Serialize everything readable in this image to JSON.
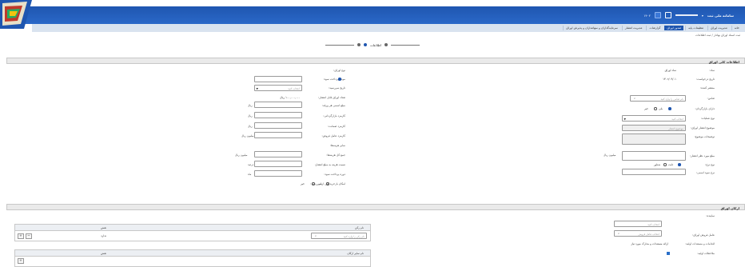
{
  "header": {
    "user": "سامانه ملی ثبت",
    "date": "۱۴۰۲"
  },
  "menu": {
    "items": [
      "خانه",
      "مدیریت اوراق",
      "تنظیمات پایه",
      "صدور اوراق",
      "گزارشات",
      "مدیریت انتشار",
      "سرمایه‌گذاران و سهامداران و پذیرش اوراق"
    ],
    "active_index": 3
  },
  "breadcrumb": "ثبت اسناد اوراق بهادار / ثبت اطلاعات",
  "wizard": {
    "step_label": "اطلاعات"
  },
  "general": {
    "title": "اطلاعات کلی اوراق",
    "right": [
      {
        "label": "نماد:",
        "value": "نماد اوراق"
      },
      {
        "label": "تاریخ درخواست:",
        "value": "۱۴۰۲/۰۹/۰۱"
      },
      {
        "label": "منتشر کننده:",
        "value": ""
      },
      {
        "label": "ضامن:",
        "placeholder": "نام ضامن را وارد کنید"
      },
      {
        "label": "دارای بازارگردان:",
        "radio_yes": "بلی",
        "radio_no": "خیر"
      },
      {
        "label": "نوع عملیات:",
        "option": "انتخاب کنید"
      },
      {
        "label": "موضوع انتشار اوراق:",
        "placeholder": "موضوع انتشار"
      },
      {
        "label": "توضیحات موضوع:",
        "value": ""
      },
      {
        "label": "مبلغ مورد نظر انتشار:",
        "unit": "میلیون ریال"
      },
      {
        "label": "نوع نرخ:",
        "radio_a": "ثابت",
        "radio_b": "شناور"
      },
      {
        "label": "نرخ سود اسمی:",
        "value": ""
      }
    ],
    "left": [
      {
        "label": "نوع اوراق:",
        "value": ""
      },
      {
        "label": "موعد پرداخت سود:",
        "value": ""
      },
      {
        "label": "تاریخ سررسید:",
        "option": "انتخاب کنید"
      },
      {
        "label": "تعداد اوراق قابل انتشار:",
        "value": "۱۰۰,۰۰۰,۰۰۰ ریال"
      },
      {
        "label": "مبلغ اسمی هر ورقه:",
        "unit": "ریال"
      },
      {
        "label": "کارمزد بازارگردانی:",
        "unit": "ریال"
      },
      {
        "label": "کارمزد ضمانت:",
        "unit": "ریال"
      },
      {
        "label": "کارمزد عامل فروش:",
        "unit": "میلیون ریال"
      },
      {
        "label": "سایر هزینه‌ها:",
        "value": ""
      },
      {
        "label": "جمع کل هزینه‌ها:",
        "unit": "میلیون ریال"
      },
      {
        "label": "نسبت هزینه به مبلغ انتشار:",
        "unit": "درصد"
      },
      {
        "label": "دوره پرداخت سود:",
        "unit": "ماه"
      },
      {
        "label": "امکان بازخرید قبل از سررسید:",
        "radio_a": "بلی",
        "radio_b": "خیر"
      }
    ]
  },
  "pillars": {
    "title": "ارکان اوراق",
    "right": [
      {
        "label": "نماینده:",
        "placeholder": "انتخاب کنید"
      },
      {
        "label": "عامل فروش اوراق:",
        "placeholder": "انتخاب عامل فروش"
      },
      {
        "label": "اقدامات و مستندات اولیه:",
        "value": "ارائه مستندات و مدارک مورد نیاز"
      },
      {
        "label": "ملاحظات اولیه:",
        "value": "توسط ناشر و ارکان"
      }
    ],
    "table1": {
      "col_right": "نام رکن",
      "col_left": "نقش",
      "cell_value": "ندارد",
      "input_placeholder": "نام رکن را وارد کنید"
    },
    "table2": {
      "col_right": "نام سایر ارکان",
      "col_left": "نقش"
    }
  }
}
